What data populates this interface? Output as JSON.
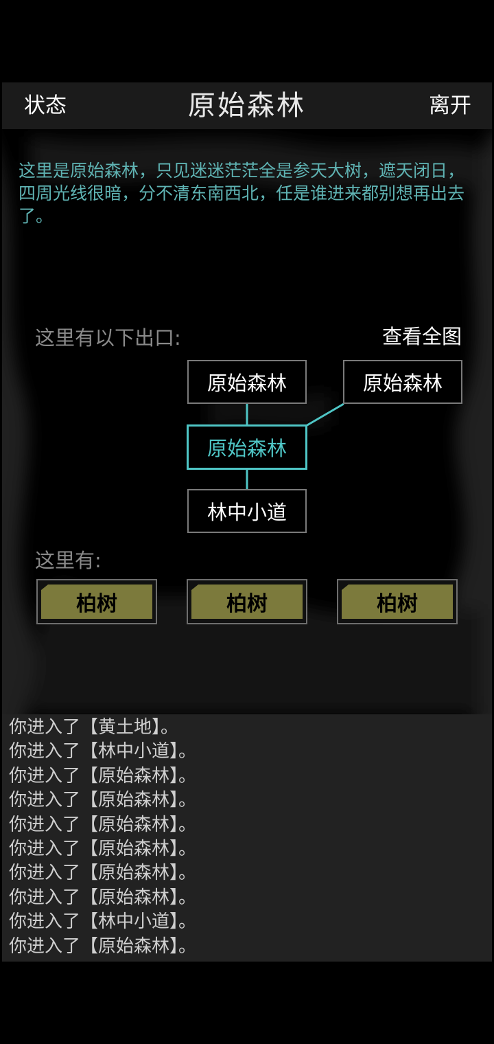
{
  "header": {
    "left_label": "状态",
    "title": "原始森林",
    "right_label": "离开"
  },
  "description": "这里是原始森林，只见迷迷茫茫全是参天大树，遮天闭日，四周光线很暗，分不清东南西北，任是谁进来都别想再出去了。",
  "exits": {
    "label": "这里有以下出口:",
    "view_map_label": "查看全图",
    "rooms": {
      "north": "原始森林",
      "northeast": "原始森林",
      "current": "原始森林",
      "south": "林中小道"
    }
  },
  "here": {
    "label": "这里有:",
    "items": [
      "柏树",
      "柏树",
      "柏树"
    ]
  },
  "log": [
    "你进入了【黄土地】。",
    "你进入了【林中小道】。",
    "你进入了【原始森林】。",
    "你进入了【原始森林】。",
    "你进入了【原始森林】。",
    "你进入了【原始森林】。",
    "你进入了【原始森林】。",
    "你进入了【原始森林】。",
    "你进入了【林中小道】。",
    "你进入了【原始森林】。"
  ],
  "colors": {
    "background": "#000000",
    "header": "#1b1b1b",
    "description_text": "#5fb3b3",
    "current_room": "#4fc6c6",
    "npc_button": "#7c7a3c",
    "log_background": "#222222"
  }
}
